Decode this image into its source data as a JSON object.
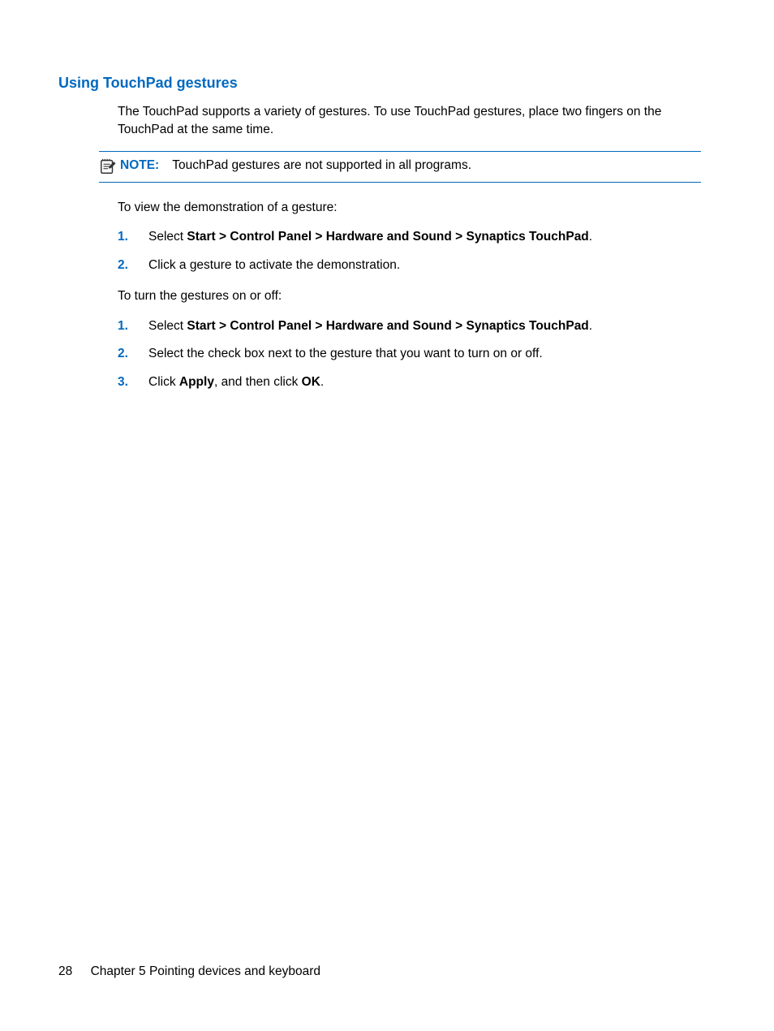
{
  "heading": "Using TouchPad gestures",
  "intro": "The TouchPad supports a variety of gestures. To use TouchPad gestures, place two fingers on the TouchPad at the same time.",
  "note": {
    "label": "NOTE:",
    "text": "TouchPad gestures are not supported in all programs."
  },
  "para_view_demo": "To view the demonstration of a gesture:",
  "steps_demo": [
    {
      "num": "1.",
      "prefix": "Select ",
      "bold": "Start > Control Panel > Hardware and Sound > Synaptics TouchPad",
      "suffix": "."
    },
    {
      "num": "2.",
      "prefix": "Click a gesture to activate the demonstration.",
      "bold": "",
      "suffix": ""
    }
  ],
  "para_toggle": "To turn the gestures on or off:",
  "steps_toggle": [
    {
      "num": "1.",
      "prefix": "Select ",
      "bold": "Start > Control Panel > Hardware and Sound > Synaptics TouchPad",
      "suffix": "."
    },
    {
      "num": "2.",
      "prefix": "Select the check box next to the gesture that you want to turn on or off.",
      "bold": "",
      "suffix": ""
    },
    {
      "num": "3.",
      "prefix": "Click ",
      "bold": "Apply",
      "mid": ", and then click ",
      "bold2": "OK",
      "suffix": "."
    }
  ],
  "footer": {
    "page": "28",
    "chapter": "Chapter 5   Pointing devices and keyboard"
  }
}
